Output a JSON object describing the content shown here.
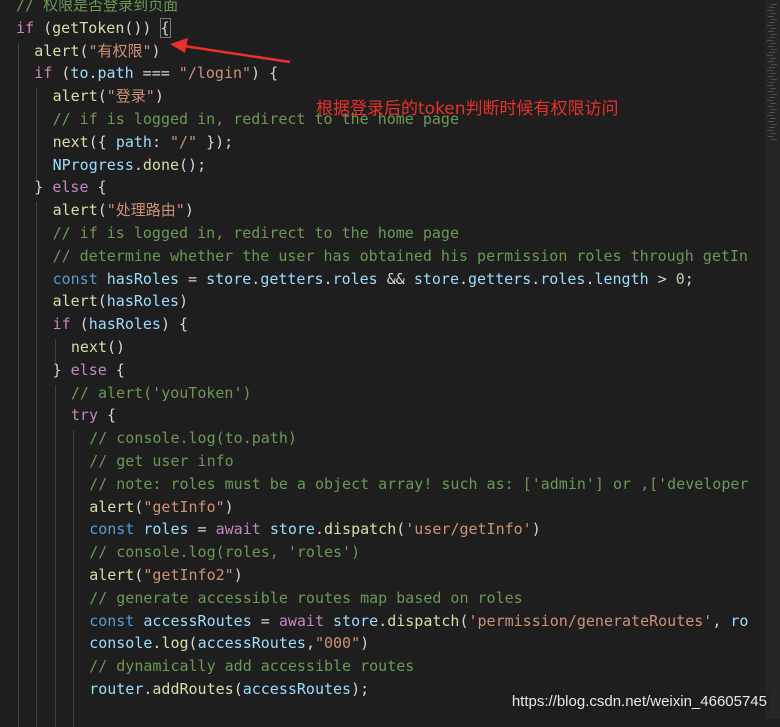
{
  "editor": {
    "lines": [
      {
        "indent": 0,
        "tokens": [
          [
            "cm",
            "// 权限是否登录到页面"
          ]
        ]
      },
      {
        "indent": 0,
        "tokens": [
          [
            "ctl",
            "if"
          ],
          [
            "op",
            " ("
          ],
          [
            "fn",
            "getToken"
          ],
          [
            "op",
            "()) "
          ],
          [
            "brace",
            "{"
          ]
        ]
      },
      {
        "indent": 1,
        "tokens": [
          [
            "fn",
            "alert"
          ],
          [
            "op",
            "("
          ],
          [
            "str",
            "\"有权限\""
          ],
          [
            "op",
            ")"
          ]
        ]
      },
      {
        "indent": 1,
        "tokens": [
          [
            "ctl",
            "if"
          ],
          [
            "op",
            " ("
          ],
          [
            "var",
            "to"
          ],
          [
            "op",
            "."
          ],
          [
            "var",
            "path"
          ],
          [
            "op",
            " === "
          ],
          [
            "str",
            "\"/login\""
          ],
          [
            "op",
            ") {"
          ]
        ]
      },
      {
        "indent": 2,
        "tokens": [
          [
            "fn",
            "alert"
          ],
          [
            "op",
            "("
          ],
          [
            "str",
            "\"登录\""
          ],
          [
            "op",
            ")"
          ]
        ]
      },
      {
        "indent": 2,
        "tokens": [
          [
            "cm",
            "// if is logged in, redirect to the home page"
          ]
        ]
      },
      {
        "indent": 2,
        "tokens": [
          [
            "fn",
            "next"
          ],
          [
            "op",
            "({ "
          ],
          [
            "var",
            "path"
          ],
          [
            "op",
            ": "
          ],
          [
            "str",
            "\"/\""
          ],
          [
            "op",
            " });"
          ]
        ]
      },
      {
        "indent": 2,
        "tokens": [
          [
            "var",
            "NProgress"
          ],
          [
            "op",
            "."
          ],
          [
            "fn",
            "done"
          ],
          [
            "op",
            "();"
          ]
        ]
      },
      {
        "indent": 1,
        "tokens": [
          [
            "op",
            "} "
          ],
          [
            "ctl",
            "else"
          ],
          [
            "op",
            " {"
          ]
        ]
      },
      {
        "indent": 2,
        "tokens": [
          [
            "fn",
            "alert"
          ],
          [
            "op",
            "("
          ],
          [
            "str",
            "\"处理路由\""
          ],
          [
            "op",
            ")"
          ]
        ]
      },
      {
        "indent": 2,
        "tokens": [
          [
            "cm",
            "// if is logged in, redirect to the home page"
          ]
        ]
      },
      {
        "indent": 2,
        "tokens": [
          [
            "cm",
            "// determine whether the user has obtained his permission roles through getIn"
          ]
        ]
      },
      {
        "indent": 2,
        "tokens": [
          [
            "kw",
            "const"
          ],
          [
            "op",
            " "
          ],
          [
            "var",
            "hasRoles"
          ],
          [
            "op",
            " = "
          ],
          [
            "var",
            "store"
          ],
          [
            "op",
            "."
          ],
          [
            "var",
            "getters"
          ],
          [
            "op",
            "."
          ],
          [
            "var",
            "roles"
          ],
          [
            "op",
            " && "
          ],
          [
            "var",
            "store"
          ],
          [
            "op",
            "."
          ],
          [
            "var",
            "getters"
          ],
          [
            "op",
            "."
          ],
          [
            "var",
            "roles"
          ],
          [
            "op",
            "."
          ],
          [
            "var",
            "length"
          ],
          [
            "op",
            " > "
          ],
          [
            "num",
            "0"
          ],
          [
            "op",
            ";"
          ]
        ]
      },
      {
        "indent": 2,
        "tokens": [
          [
            "fn",
            "alert"
          ],
          [
            "op",
            "("
          ],
          [
            "var",
            "hasRoles"
          ],
          [
            "op",
            ")"
          ]
        ]
      },
      {
        "indent": 2,
        "tokens": [
          [
            "ctl",
            "if"
          ],
          [
            "op",
            " ("
          ],
          [
            "var",
            "hasRoles"
          ],
          [
            "op",
            ") {"
          ]
        ]
      },
      {
        "indent": 3,
        "tokens": [
          [
            "fn",
            "next"
          ],
          [
            "op",
            "()"
          ]
        ]
      },
      {
        "indent": 2,
        "tokens": [
          [
            "op",
            "} "
          ],
          [
            "ctl",
            "else"
          ],
          [
            "op",
            " {"
          ]
        ]
      },
      {
        "indent": 3,
        "tokens": [
          [
            "cm",
            "// alert('youToken')"
          ]
        ]
      },
      {
        "indent": 3,
        "tokens": [
          [
            "ctl",
            "try"
          ],
          [
            "op",
            " {"
          ]
        ]
      },
      {
        "indent": 4,
        "tokens": [
          [
            "cm",
            "// console.log(to.path)"
          ]
        ]
      },
      {
        "indent": 4,
        "tokens": [
          [
            "cm",
            "// get user info"
          ]
        ]
      },
      {
        "indent": 4,
        "tokens": [
          [
            "cm",
            "// note: roles must be a object array! such as: ['admin'] or ,['developer"
          ]
        ]
      },
      {
        "indent": 4,
        "tokens": [
          [
            "fn",
            "alert"
          ],
          [
            "op",
            "("
          ],
          [
            "str",
            "\"getInfo\""
          ],
          [
            "op",
            ")"
          ]
        ]
      },
      {
        "indent": 4,
        "tokens": [
          [
            "kw",
            "const"
          ],
          [
            "op",
            " "
          ],
          [
            "var",
            "roles"
          ],
          [
            "op",
            " = "
          ],
          [
            "ctl",
            "await"
          ],
          [
            "op",
            " "
          ],
          [
            "var",
            "store"
          ],
          [
            "op",
            "."
          ],
          [
            "fn",
            "dispatch"
          ],
          [
            "op",
            "("
          ],
          [
            "str",
            "'user/getInfo'"
          ],
          [
            "op",
            ")"
          ]
        ]
      },
      {
        "indent": 4,
        "tokens": [
          [
            "cm",
            "// console.log(roles, 'roles')"
          ]
        ]
      },
      {
        "indent": 4,
        "tokens": [
          [
            "fn",
            "alert"
          ],
          [
            "op",
            "("
          ],
          [
            "str",
            "\"getInfo2\""
          ],
          [
            "op",
            ")"
          ]
        ]
      },
      {
        "indent": 4,
        "tokens": [
          [
            "cm",
            "// generate accessible routes map based on roles"
          ]
        ]
      },
      {
        "indent": 4,
        "tokens": [
          [
            "kw",
            "const"
          ],
          [
            "op",
            " "
          ],
          [
            "var",
            "accessRoutes"
          ],
          [
            "op",
            " = "
          ],
          [
            "ctl",
            "await"
          ],
          [
            "op",
            " "
          ],
          [
            "var",
            "store"
          ],
          [
            "op",
            "."
          ],
          [
            "fn",
            "dispatch"
          ],
          [
            "op",
            "("
          ],
          [
            "str",
            "'permission/generateRoutes'"
          ],
          [
            "op",
            ", "
          ],
          [
            "var",
            "ro"
          ]
        ]
      },
      {
        "indent": 4,
        "tokens": [
          [
            "var",
            "console"
          ],
          [
            "op",
            "."
          ],
          [
            "fn",
            "log"
          ],
          [
            "op",
            "("
          ],
          [
            "var",
            "accessRoutes"
          ],
          [
            "op",
            ","
          ],
          [
            "str",
            "\"000\""
          ],
          [
            "op",
            ")"
          ]
        ]
      },
      {
        "indent": 4,
        "tokens": [
          [
            "cm",
            "// dynamically add accessible routes"
          ]
        ]
      },
      {
        "indent": 4,
        "tokens": [
          [
            "var",
            "router"
          ],
          [
            "op",
            "."
          ],
          [
            "fn",
            "addRoutes"
          ],
          [
            "op",
            "("
          ],
          [
            "var",
            "accessRoutes"
          ],
          [
            "op",
            ");"
          ]
        ]
      },
      {
        "indent": 4,
        "tokens": []
      }
    ]
  },
  "annotation": {
    "text": "根据登录后的token判断时候有权限访问",
    "color": "#e8312a"
  },
  "watermark": {
    "text": "https://blog.csdn.net/weixin_46605745"
  },
  "colors": {
    "background": "#1e1e1e",
    "keyword": "#569cd6",
    "control": "#c586c0",
    "function": "#dcdcaa",
    "string": "#ce9178",
    "comment": "#6a9955",
    "variable": "#9cdcfe",
    "number": "#b5cea8"
  }
}
